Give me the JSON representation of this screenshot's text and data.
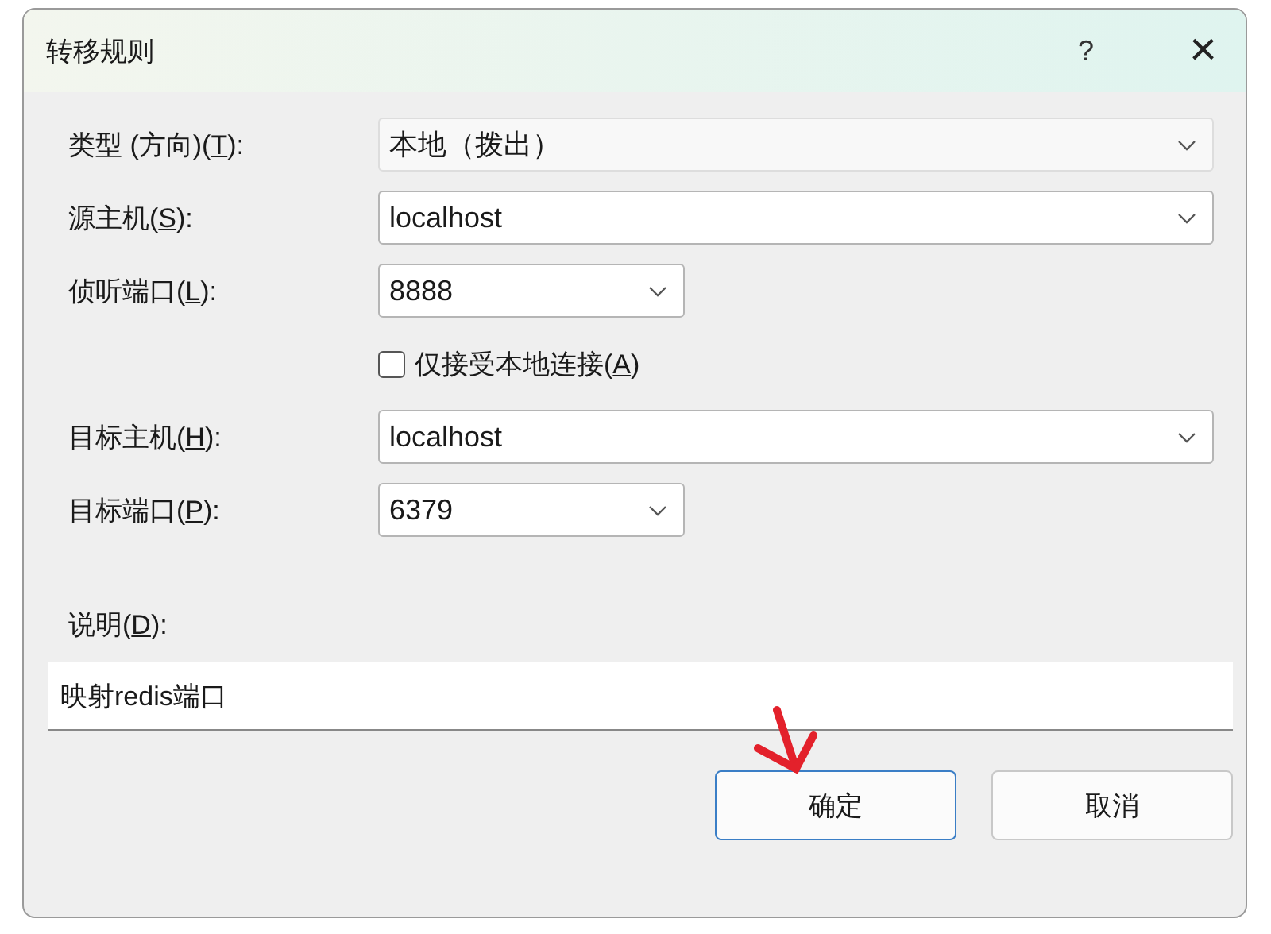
{
  "window": {
    "title": "转移规则",
    "help": "?",
    "close": "×"
  },
  "fields": [
    {
      "label": {
        "before": "类型 (方向)(",
        "key": "T",
        "after": "):"
      },
      "value": "本地（拨出）",
      "kind": "dropdown"
    },
    {
      "label": {
        "before": "源主机(",
        "key": "S",
        "after": "):"
      },
      "value": "localhost",
      "kind": "combo"
    },
    {
      "label": {
        "before": "侦听端口(",
        "key": "L",
        "after": "):"
      },
      "value": "8888",
      "kind": "short-combo"
    },
    {
      "label": {
        "before": "仅接受本地连接(",
        "key": "A",
        "after": ")"
      },
      "kind": "checkbox",
      "checked": false
    },
    {
      "label": {
        "before": "目标主机(",
        "key": "H",
        "after": "):"
      },
      "value": "localhost",
      "kind": "combo"
    },
    {
      "label": {
        "before": "目标端口(",
        "key": "P",
        "after": "):"
      },
      "value": "6379",
      "kind": "short-combo"
    }
  ],
  "description": {
    "label": {
      "before": "说明(",
      "key": "D",
      "after": "):"
    },
    "value": "映射redis端口"
  },
  "buttons": [
    {
      "label": "确定",
      "default": true
    },
    {
      "label": "取消",
      "default": false
    }
  ],
  "annotation": {
    "kind": "arrow",
    "color": "#e3212b"
  }
}
